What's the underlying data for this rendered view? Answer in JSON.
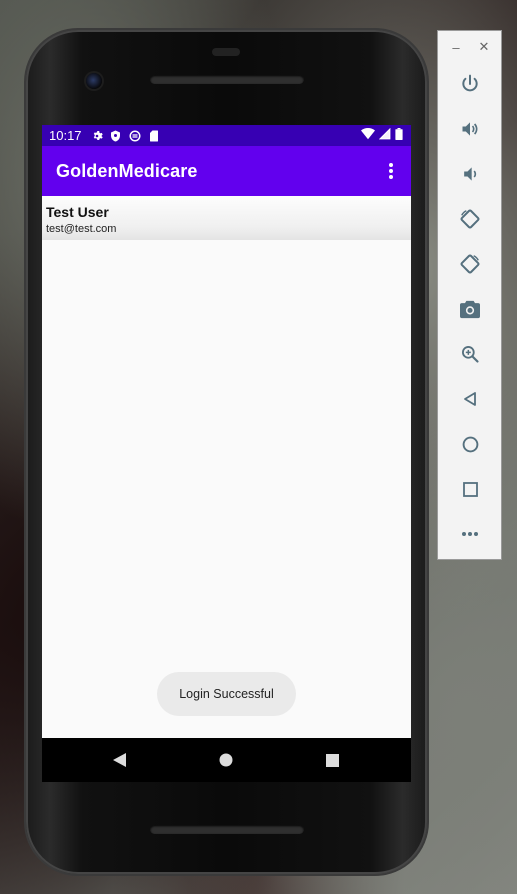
{
  "status_bar": {
    "time": "10:17",
    "icons_left": [
      "settings-icon",
      "shield-icon",
      "data-saver-icon",
      "sd-card-icon"
    ],
    "icons_right": [
      "wifi-icon",
      "signal-icon",
      "battery-icon"
    ]
  },
  "app_bar": {
    "title": "GoldenMedicare",
    "menu_icon": "more-vert-icon"
  },
  "user_list": [
    {
      "name": "Test User",
      "email": "test@test.com"
    }
  ],
  "toast": {
    "message": "Login Successful"
  },
  "nav_bar": {
    "buttons": [
      "back-icon",
      "home-icon",
      "recents-icon"
    ]
  },
  "emulator_panel": {
    "window_buttons": [
      "minimize-icon",
      "close-icon"
    ],
    "minimize_glyph": "–",
    "close_glyph": "✕",
    "controls": [
      "power-icon",
      "volume-up-icon",
      "volume-down-icon",
      "rotate-left-icon",
      "rotate-right-icon",
      "screenshot-icon",
      "zoom-icon",
      "back-icon",
      "home-icon",
      "overview-icon",
      "more-icon"
    ]
  },
  "colors": {
    "status_bar": "#3700b3",
    "app_bar": "#6200ee",
    "screen_bg": "#fafafa",
    "toast_bg": "#eaeaea",
    "emulator_icon": "#55707e"
  }
}
